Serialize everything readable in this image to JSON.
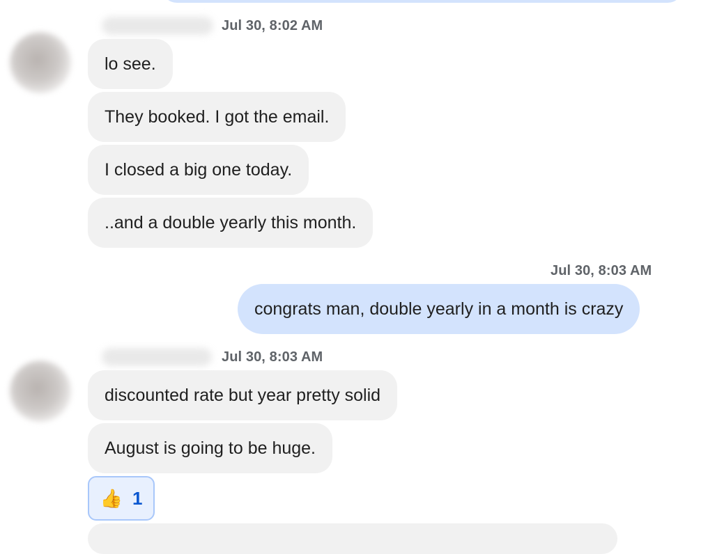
{
  "thread": {
    "messages_group_1": {
      "timestamp": "Jul 30, 8:02 AM",
      "messages": [
        "lo see.",
        "They booked. I got the email.",
        "I closed a big one today.",
        "..and a double yearly this month."
      ]
    },
    "outgoing": {
      "timestamp": "Jul 30, 8:03 AM",
      "message": "congrats man, double yearly in a month is crazy"
    },
    "messages_group_2": {
      "timestamp": "Jul 30, 8:03 AM",
      "messages": [
        "discounted rate but year pretty solid",
        "August is going to be huge."
      ],
      "reaction": {
        "emoji": "👍",
        "count": "1"
      }
    }
  },
  "colors": {
    "incoming_bubble": "#f1f1f1",
    "outgoing_bubble": "#d3e3fd",
    "reaction_accent": "#0b57d0",
    "timestamp": "#5f6368"
  }
}
